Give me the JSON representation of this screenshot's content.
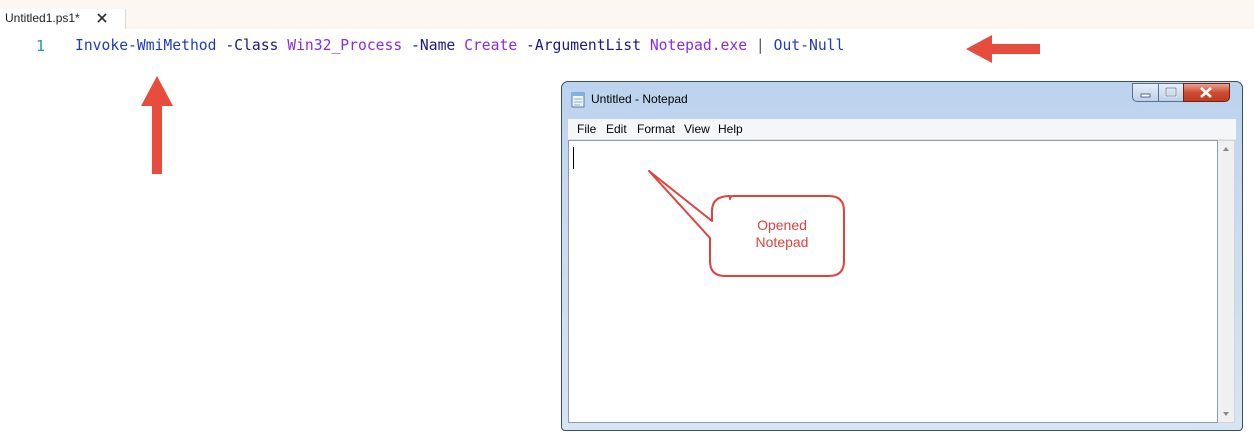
{
  "editor": {
    "tab": {
      "label": "Untitled1.ps1*",
      "close_icon": "close-icon"
    },
    "line_number": "1",
    "code_tokens": {
      "cmdlet": "Invoke-WmiMethod",
      "param_class": " -Class ",
      "value_class": "Win32_Process",
      "param_name": " -Name ",
      "value_name": "Create",
      "param_arglist": " -ArgumentList ",
      "value_arglist": "Notepad.exe",
      "pipe": " | ",
      "out_null": "Out-Null"
    },
    "colors": {
      "cmdlet": "#1f3cbf",
      "parameter": "#1a1a80",
      "argument": "#8a2be2",
      "line_number": "#2b91af",
      "annotation": "#e3413b"
    }
  },
  "notepad": {
    "title": "Untitled - Notepad",
    "icon": "notepad-icon",
    "controls": {
      "minimize_icon": "minimize-icon",
      "maximize_icon": "maximize-icon",
      "close_icon": "close-icon"
    },
    "menu": [
      "File",
      "Edit",
      "Format",
      "View",
      "Help"
    ],
    "content": ""
  },
  "annotation": {
    "callout_text_line1": "Opened",
    "callout_text_line2": "Notepad",
    "arrows": [
      "arrow-left-icon",
      "arrow-up-icon"
    ]
  }
}
